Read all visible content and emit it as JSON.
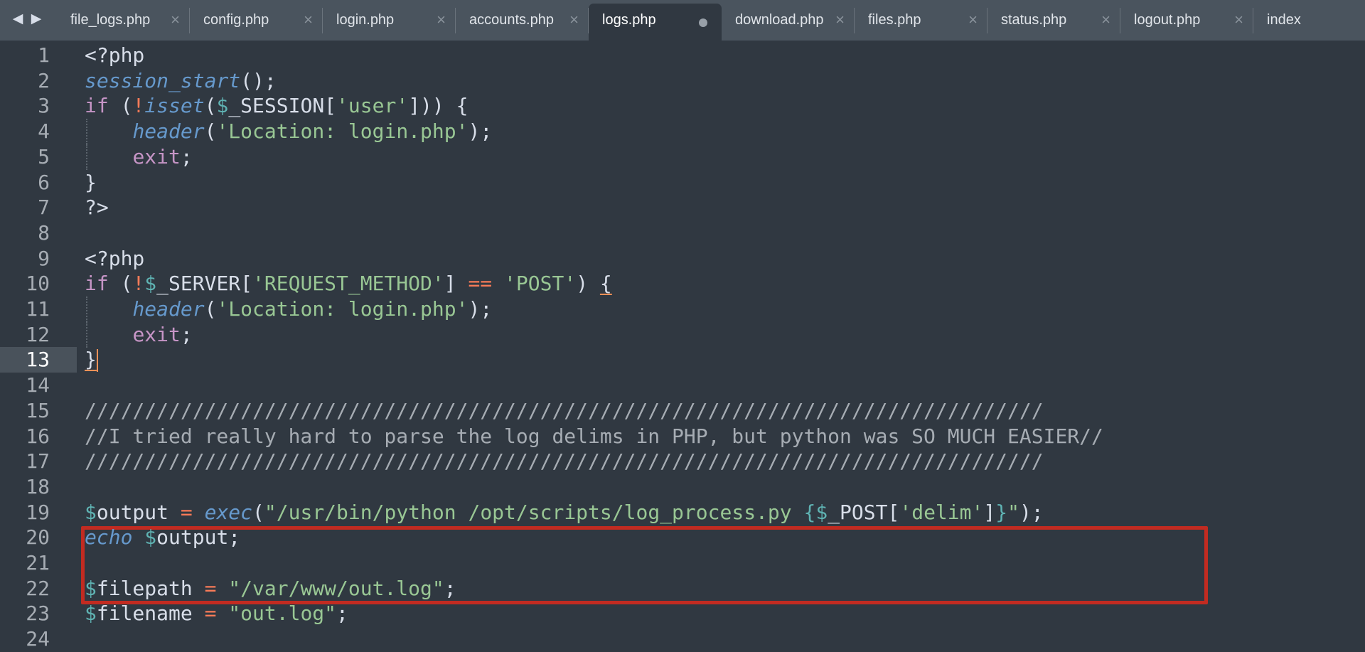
{
  "tabbar": {
    "tabs": [
      {
        "label": "file_logs.php",
        "active": false
      },
      {
        "label": "config.php",
        "active": false
      },
      {
        "label": "login.php",
        "active": false
      },
      {
        "label": "accounts.php",
        "active": false
      },
      {
        "label": "logs.php",
        "active": true,
        "dirty": true
      },
      {
        "label": "download.php",
        "active": false
      },
      {
        "label": "files.php",
        "active": false
      },
      {
        "label": "status.php",
        "active": false
      },
      {
        "label": "logout.php",
        "active": false
      },
      {
        "label": "index",
        "active": false
      }
    ],
    "close_glyph": "×",
    "prev_glyph": "◀",
    "next_glyph": "▶"
  },
  "editor": {
    "current_line": 13,
    "highlight_lines": [
      19,
      20,
      21
    ],
    "highlight_color": "#c22b21",
    "lines": [
      {
        "n": "1",
        "tokens": [
          {
            "t": "<?php",
            "c": "plain"
          }
        ]
      },
      {
        "n": "2",
        "tokens": [
          {
            "t": "session_start",
            "c": "fn"
          },
          {
            "t": "();",
            "c": "plain"
          }
        ]
      },
      {
        "n": "3",
        "tokens": [
          {
            "t": "if",
            "c": "kw"
          },
          {
            "t": " (",
            "c": "plain"
          },
          {
            "t": "!",
            "c": "op"
          },
          {
            "t": "isset",
            "c": "fn"
          },
          {
            "t": "(",
            "c": "plain"
          },
          {
            "t": "$",
            "c": "var"
          },
          {
            "t": "_SESSION[",
            "c": "plain"
          },
          {
            "t": "'user'",
            "c": "str"
          },
          {
            "t": "])) {",
            "c": "plain"
          }
        ]
      },
      {
        "n": "4",
        "guide": true,
        "tokens": [
          {
            "t": "    ",
            "c": "plain"
          },
          {
            "t": "header",
            "c": "fn"
          },
          {
            "t": "(",
            "c": "plain"
          },
          {
            "t": "'Location: login.php'",
            "c": "str"
          },
          {
            "t": ");",
            "c": "plain"
          }
        ]
      },
      {
        "n": "5",
        "guide": true,
        "tokens": [
          {
            "t": "    ",
            "c": "plain"
          },
          {
            "t": "exit",
            "c": "kw"
          },
          {
            "t": ";",
            "c": "plain"
          }
        ]
      },
      {
        "n": "6",
        "tokens": [
          {
            "t": "}",
            "c": "plain"
          }
        ]
      },
      {
        "n": "7",
        "tokens": [
          {
            "t": "?>",
            "c": "plain"
          }
        ]
      },
      {
        "n": "8",
        "tokens": []
      },
      {
        "n": "9",
        "tokens": [
          {
            "t": "<?php",
            "c": "plain"
          }
        ]
      },
      {
        "n": "10",
        "tokens": [
          {
            "t": "if",
            "c": "kw"
          },
          {
            "t": " (",
            "c": "plain"
          },
          {
            "t": "!",
            "c": "op"
          },
          {
            "t": "$",
            "c": "var"
          },
          {
            "t": "_SERVER[",
            "c": "plain"
          },
          {
            "t": "'REQUEST_METHOD'",
            "c": "str"
          },
          {
            "t": "] ",
            "c": "plain"
          },
          {
            "t": "==",
            "c": "op"
          },
          {
            "t": " ",
            "c": "plain"
          },
          {
            "t": "'POST'",
            "c": "str"
          },
          {
            "t": ") ",
            "c": "plain"
          },
          {
            "t": "{",
            "c": "brace-match"
          }
        ]
      },
      {
        "n": "11",
        "guide": true,
        "tokens": [
          {
            "t": "    ",
            "c": "plain"
          },
          {
            "t": "header",
            "c": "fn"
          },
          {
            "t": "(",
            "c": "plain"
          },
          {
            "t": "'Location: login.php'",
            "c": "str"
          },
          {
            "t": ");",
            "c": "plain"
          }
        ]
      },
      {
        "n": "12",
        "guide": true,
        "tokens": [
          {
            "t": "    ",
            "c": "plain"
          },
          {
            "t": "exit",
            "c": "kw"
          },
          {
            "t": ";",
            "c": "plain"
          }
        ]
      },
      {
        "n": "13",
        "cursor": true,
        "tokens": [
          {
            "t": "}",
            "c": "brace-match"
          }
        ]
      },
      {
        "n": "14",
        "tokens": []
      },
      {
        "n": "15",
        "tokens": [
          {
            "t": "////////////////////////////////////////////////////////////////////////////////",
            "c": "cm"
          }
        ]
      },
      {
        "n": "16",
        "tokens": [
          {
            "t": "//I tried really hard to parse the log delims in PHP, but python was SO MUCH EASIER//",
            "c": "cm"
          }
        ]
      },
      {
        "n": "17",
        "tokens": [
          {
            "t": "////////////////////////////////////////////////////////////////////////////////",
            "c": "cm"
          }
        ]
      },
      {
        "n": "18",
        "tokens": []
      },
      {
        "n": "19",
        "tokens": [
          {
            "t": "$",
            "c": "var"
          },
          {
            "t": "output ",
            "c": "plain"
          },
          {
            "t": "=",
            "c": "op"
          },
          {
            "t": " ",
            "c": "plain"
          },
          {
            "t": "exec",
            "c": "fn"
          },
          {
            "t": "(",
            "c": "plain"
          },
          {
            "t": "\"/usr/bin/python /opt/scripts/log_process.py ",
            "c": "str"
          },
          {
            "t": "{",
            "c": "var"
          },
          {
            "t": "$",
            "c": "var"
          },
          {
            "t": "_POST[",
            "c": "plain"
          },
          {
            "t": "'delim'",
            "c": "str"
          },
          {
            "t": "]",
            "c": "plain"
          },
          {
            "t": "}",
            "c": "var"
          },
          {
            "t": "\"",
            "c": "str"
          },
          {
            "t": ");",
            "c": "plain"
          }
        ]
      },
      {
        "n": "20",
        "tokens": [
          {
            "t": "echo",
            "c": "fn"
          },
          {
            "t": " ",
            "c": "plain"
          },
          {
            "t": "$",
            "c": "var"
          },
          {
            "t": "output;",
            "c": "plain"
          }
        ]
      },
      {
        "n": "21",
        "tokens": []
      },
      {
        "n": "22",
        "tokens": [
          {
            "t": "$",
            "c": "var"
          },
          {
            "t": "filepath ",
            "c": "plain"
          },
          {
            "t": "=",
            "c": "op"
          },
          {
            "t": " ",
            "c": "plain"
          },
          {
            "t": "\"/var/www/out.log\"",
            "c": "str"
          },
          {
            "t": ";",
            "c": "plain"
          }
        ]
      },
      {
        "n": "23",
        "tokens": [
          {
            "t": "$",
            "c": "var"
          },
          {
            "t": "filename ",
            "c": "plain"
          },
          {
            "t": "=",
            "c": "op"
          },
          {
            "t": " ",
            "c": "plain"
          },
          {
            "t": "\"out.log\"",
            "c": "str"
          },
          {
            "t": ";",
            "c": "plain"
          }
        ]
      },
      {
        "n": "24",
        "tokens": []
      }
    ]
  }
}
